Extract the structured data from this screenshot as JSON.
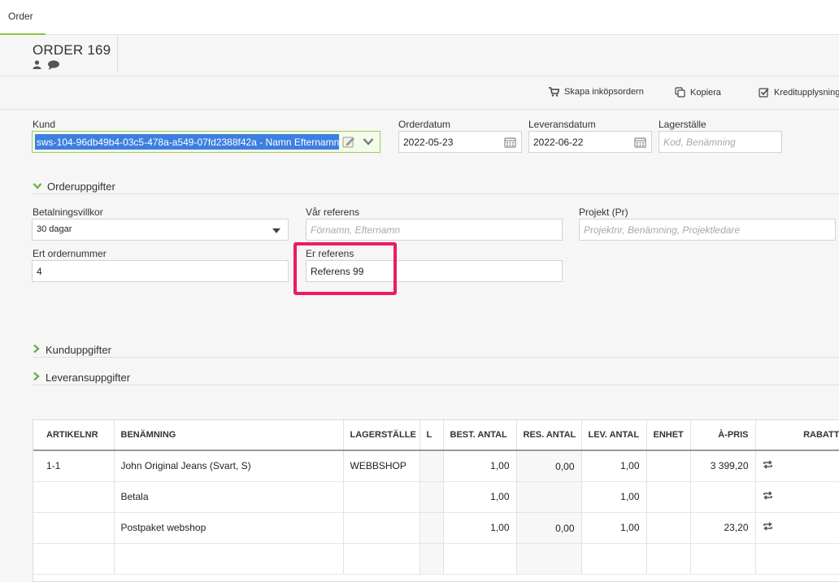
{
  "tabs": {
    "active": "Order"
  },
  "header": {
    "title": "ORDER 169"
  },
  "toolbar": {
    "purchase_order": "Skapa inköpsordern",
    "copy": "Kopiera",
    "credit_check": "Kreditupplysning"
  },
  "form": {
    "kund_label": "Kund",
    "kund_value": "sws-104-96db49b4-03c5-478a-a549-07fd2388f42a - Namn Efternamn",
    "orderdatum_label": "Orderdatum",
    "orderdatum_value": "2022-05-23",
    "leveransdatum_label": "Leveransdatum",
    "leveransdatum_value": "2022-06-22",
    "lagerstalle_label": "Lagerställe",
    "lagerstalle_placeholder": "Kod, Benämning"
  },
  "orderuppgifter": {
    "title": "Orderuppgifter",
    "betalningsvillkor_label": "Betalningsvillkor",
    "betalningsvillkor_value": "30 dagar",
    "var_referens_label": "Vår referens",
    "var_referens_placeholder": "Förnamn, Efternamn",
    "projekt_label": "Projekt (Pr)",
    "projekt_placeholder": "Projektnr, Benämning, Projektledare",
    "ert_ordernummer_label": "Ert ordernummer",
    "ert_ordernummer_value": "4",
    "er_referens_label": "Er referens",
    "er_referens_value": "Referens 99"
  },
  "sections": {
    "kunduppgifter": "Kunduppgifter",
    "leveransuppgifter": "Leveransuppgifter"
  },
  "table": {
    "columns": [
      "ARTIKELNR",
      "BENÄMNING",
      "LAGERSTÄLLE",
      "L",
      "BEST. ANTAL",
      "RES. ANTAL",
      "LEV. ANTAL",
      "ENHET",
      "À-PRIS",
      "RABATT"
    ],
    "rows": [
      {
        "artikelnr": "1-1",
        "benamning": "John Original Jeans (Svart, S)",
        "lagerstalle": "WEBBSHOP",
        "l": "",
        "best": "1,00",
        "res": "0,00",
        "lev": "1,00",
        "enhet": "",
        "apris": "3 399,20",
        "rabatt": ""
      },
      {
        "artikelnr": "",
        "benamning": "Betala",
        "lagerstalle": "",
        "l": "",
        "best": "1,00",
        "res": "",
        "lev": "1,00",
        "enhet": "",
        "apris": "",
        "rabatt": ""
      },
      {
        "artikelnr": "",
        "benamning": "Postpaket webshop",
        "lagerstalle": "",
        "l": "",
        "best": "1,00",
        "res": "0,00",
        "lev": "1,00",
        "enhet": "",
        "apris": "23,20",
        "rabatt": ""
      },
      {
        "artikelnr": "",
        "benamning": "",
        "lagerstalle": "",
        "l": "",
        "best": "",
        "res": "",
        "lev": "",
        "enhet": "",
        "apris": "",
        "rabatt": ""
      }
    ]
  },
  "colors": {
    "accent_green": "#8cc63f",
    "highlight": "#ef1a5f",
    "selection_blue": "#3d7fe0"
  }
}
